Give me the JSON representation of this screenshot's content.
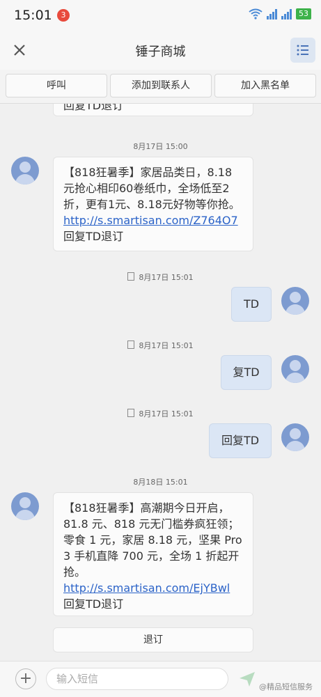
{
  "status": {
    "time": "15:01",
    "notification_count": "3",
    "battery": "53"
  },
  "header": {
    "title": "锤子商城"
  },
  "actions": {
    "call": "呼叫",
    "add_contact": "添加到联系人",
    "blacklist": "加入黑名单"
  },
  "messages": {
    "partial_top": "回复TD退订",
    "ts1": "8月17日 15:00",
    "msg1_text": "【818狂暑季】家居品类日，8.18元抢心相印60卷纸巾，全场低至2折，更有1元、8.18元好物等你抢。",
    "msg1_link": "http://s.smartisan.com/Z764O7",
    "msg1_tail": "回复TD退订",
    "ts2": "8月17日 15:01",
    "out1": "TD",
    "ts3": "8月17日 15:01",
    "out2": "复TD",
    "ts4": "8月17日 15:01",
    "out3": "回复TD",
    "ts5": "8月18日 15:01",
    "msg2_text": "【818狂暑季】高潮期今日开启，81.8 元、818 元无门槛券疯狂领；零食 1 元，家居 8.18 元，坚果 Pro 3 手机直降 700 元，全场 1 折起开抢。",
    "msg2_link": "http://s.smartisan.com/EjYBwl",
    "msg2_tail": "回复TD退订",
    "quick_reply": "退订"
  },
  "composer": {
    "placeholder": "输入短信",
    "brand": "@精品短信服务"
  },
  "colors": {
    "accent": "#2b63c8",
    "avatar": "#7d9bd0",
    "bubble_out": "#dbe6f5"
  }
}
